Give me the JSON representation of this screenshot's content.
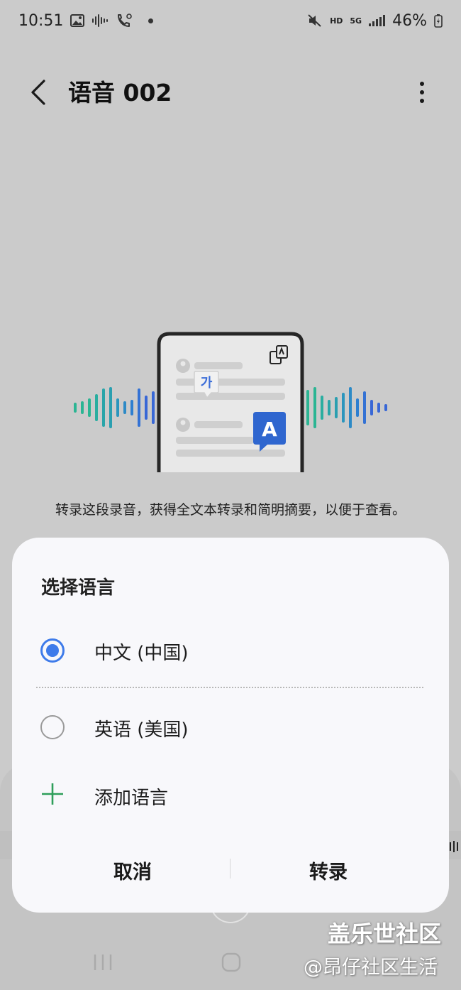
{
  "status_bar": {
    "time": "10:51",
    "battery": "46%",
    "network_hd": "HD",
    "network_5g": "5G"
  },
  "header": {
    "title": "语音 002"
  },
  "illustration": {
    "bubble_korean": "가",
    "bubble_latin": "A",
    "wave_colors": [
      "#2bb593",
      "#2a9fb0",
      "#2e7fd0",
      "#3867d6"
    ]
  },
  "description": "转录这段录音，获得全文本转录和简明摘要，以便于查看。",
  "dialog": {
    "title": "选择语言",
    "options": [
      {
        "label": "中文 (中国)",
        "selected": true
      },
      {
        "label": "英语 (美国)",
        "selected": false
      }
    ],
    "add_label": "添加语言",
    "cancel_label": "取消",
    "confirm_label": "转录",
    "accent_color": "#3e7bea",
    "plus_color": "#2e9e5a"
  },
  "watermark": {
    "line1": "盖乐世社区",
    "line2": "@昂仔社区生活"
  }
}
